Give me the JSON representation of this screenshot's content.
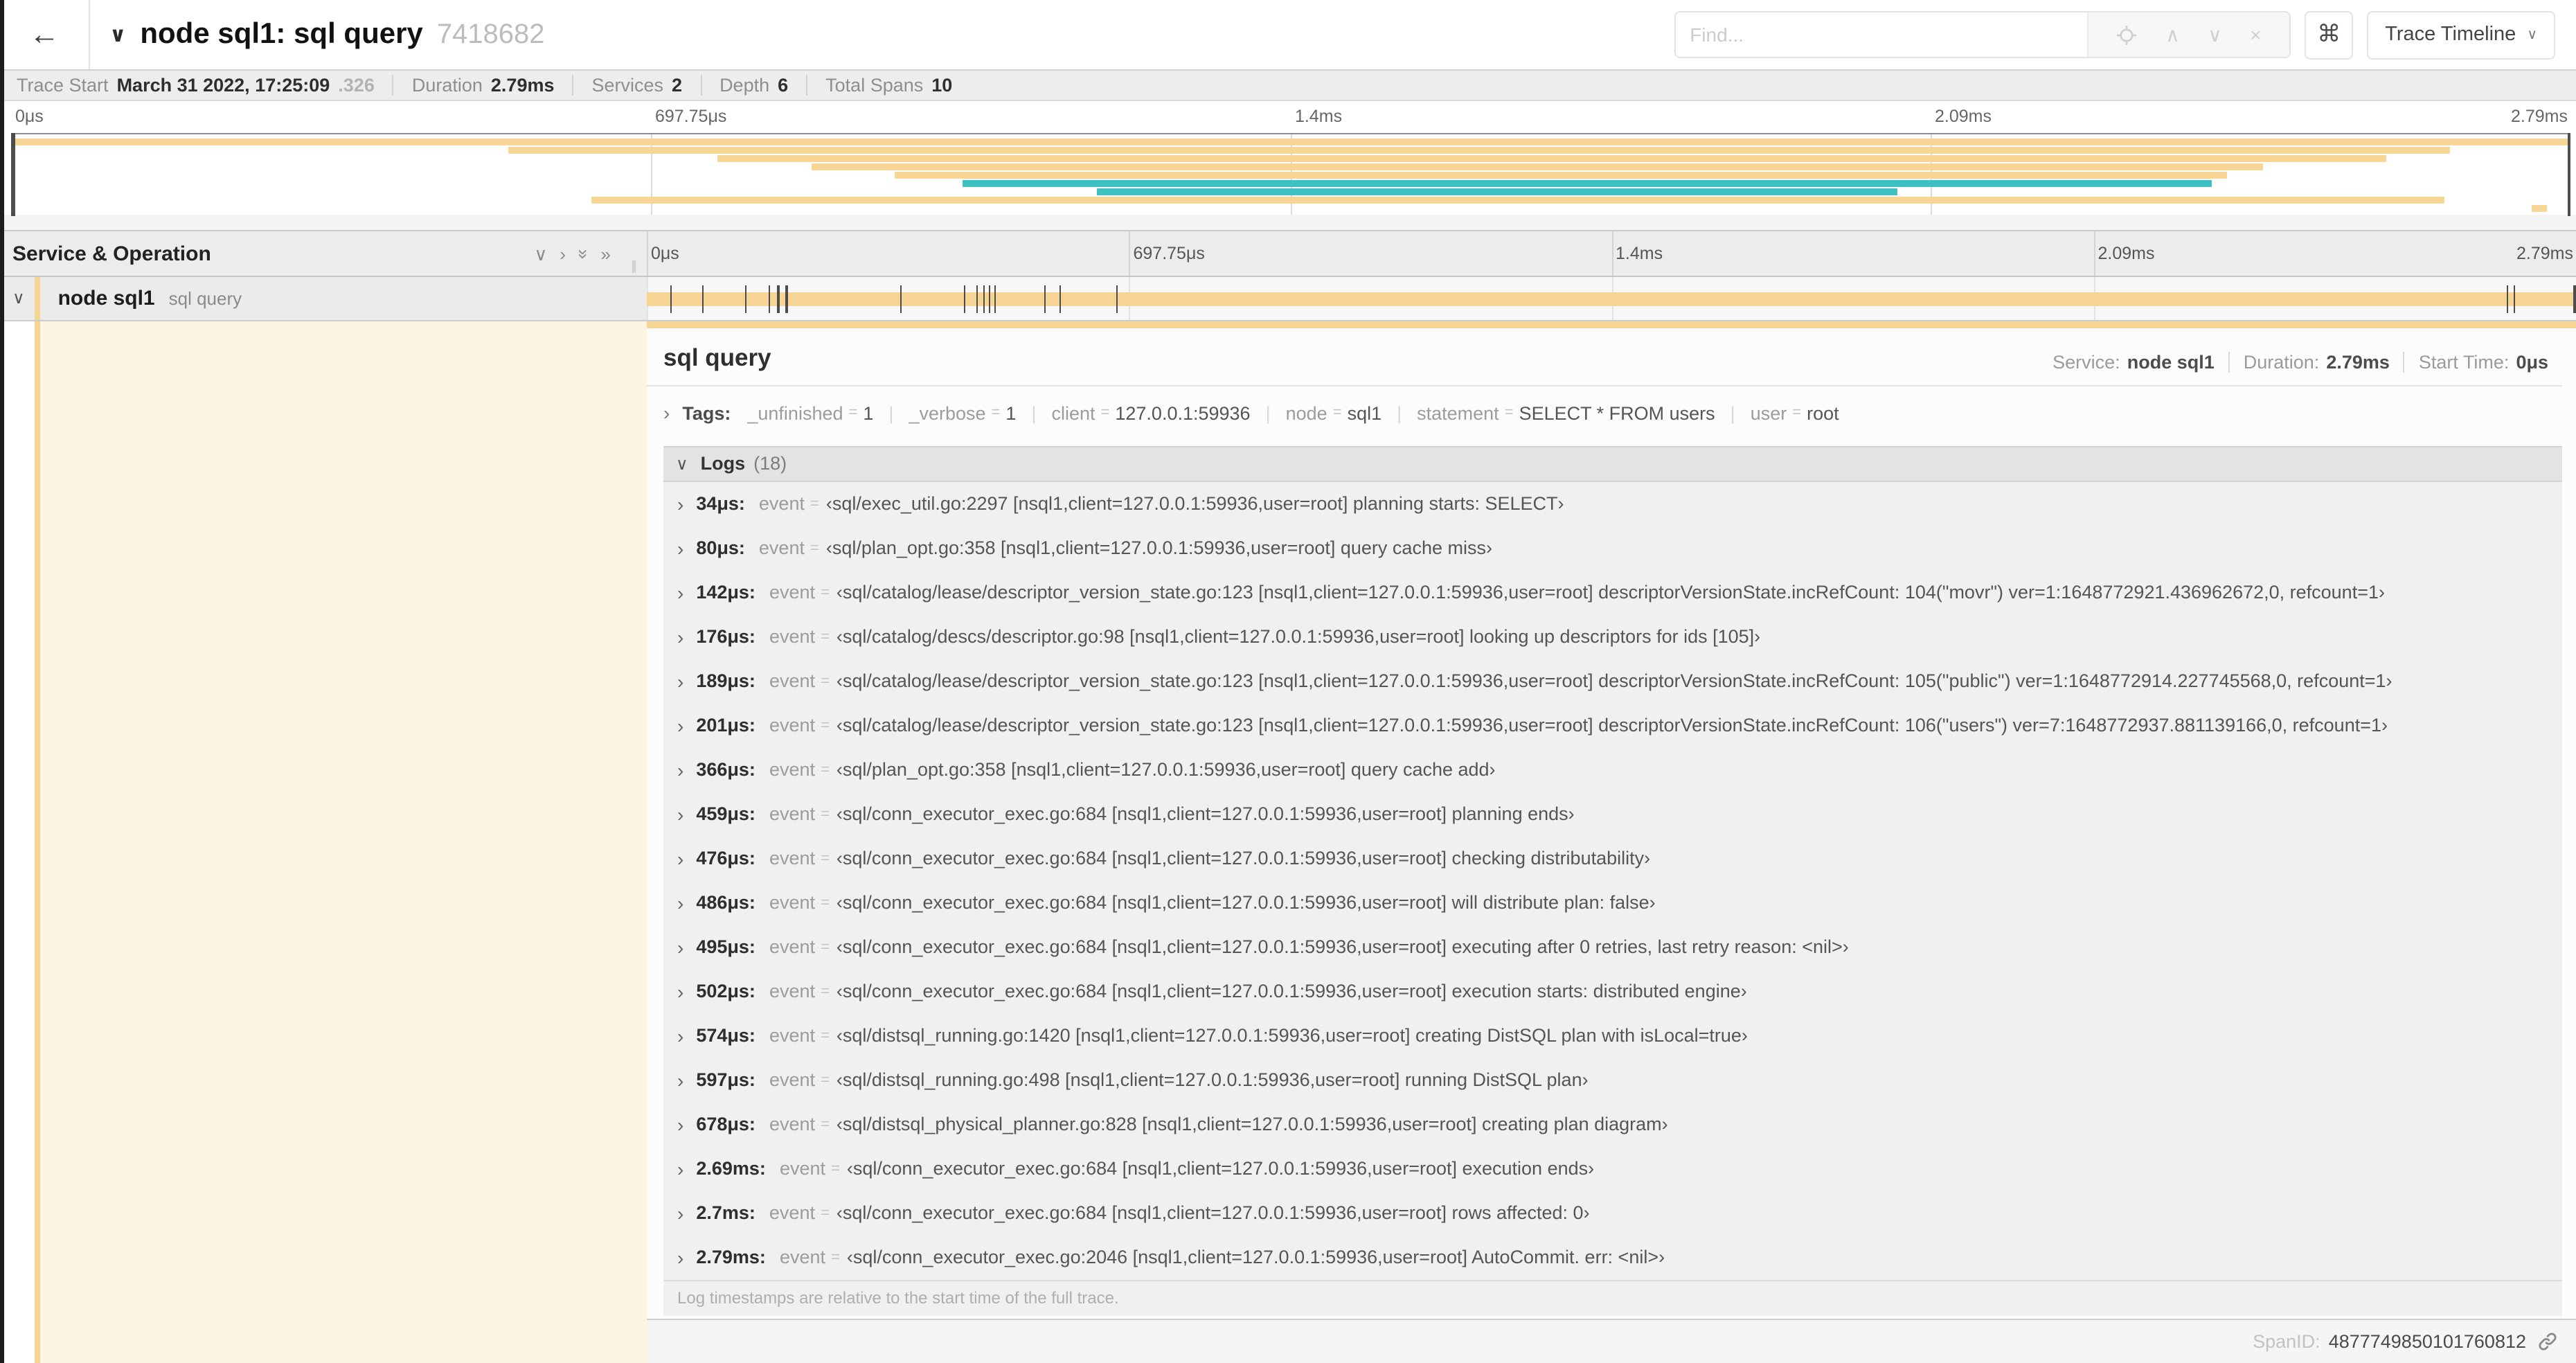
{
  "colors": {
    "tan": "#f6d595",
    "teal": "#3fc0c0",
    "cream": "#fdf5e2"
  },
  "duration_us": 2790,
  "header": {
    "back": "←",
    "title_chevron": "∨",
    "title": "node sql1: sql query",
    "trace_id": "7418682",
    "find_placeholder": "Find...",
    "shortcut": "⌘",
    "view_selector": "Trace Timeline",
    "view_chevron": "∨"
  },
  "summary": {
    "trace_start_label": "Trace Start",
    "trace_start": "March 31 2022, 17:25:09",
    "trace_start_frac": ".326",
    "duration_label": "Duration",
    "duration": "2.79ms",
    "services_label": "Services",
    "services": "2",
    "depth_label": "Depth",
    "depth": "6",
    "total_spans_label": "Total Spans",
    "total_spans": "10"
  },
  "ticks": [
    {
      "label": "0μs",
      "pos": 0
    },
    {
      "label": "697.75μs",
      "pos": 0.25
    },
    {
      "label": "1.4ms",
      "pos": 0.5
    },
    {
      "label": "2.09ms",
      "pos": 0.75
    },
    {
      "label": "2.79ms",
      "pos": 1
    }
  ],
  "minimap": {
    "spans": [
      {
        "s": 0.0,
        "e": 1.0,
        "c": "tan"
      },
      {
        "s": 0.194,
        "e": 0.953,
        "c": "tan"
      },
      {
        "s": 0.276,
        "e": 0.928,
        "c": "tan"
      },
      {
        "s": 0.313,
        "e": 0.88,
        "c": "tan"
      },
      {
        "s": 0.345,
        "e": 0.866,
        "c": "tan"
      },
      {
        "s": 0.372,
        "e": 0.86,
        "c": "teal"
      },
      {
        "s": 0.424,
        "e": 0.737,
        "c": "teal"
      },
      {
        "s": 0.227,
        "e": 0.951,
        "c": "tan"
      },
      {
        "s": 0.985,
        "e": 0.991,
        "c": "tan"
      }
    ]
  },
  "timeline": {
    "left_header": "Service & Operation"
  },
  "span_row": {
    "chevron": "∨",
    "service": "node sql1",
    "operation": "sql query"
  },
  "detail": {
    "title": "sql query",
    "service_label": "Service:",
    "service": "node sql1",
    "duration_label": "Duration:",
    "duration": "2.79ms",
    "start_label": "Start Time:",
    "start": "0μs",
    "tags_chevron": "›",
    "tags_label": "Tags:",
    "tags": [
      {
        "key": "_unfinished",
        "value": "1"
      },
      {
        "key": "_verbose",
        "value": "1"
      },
      {
        "key": "client",
        "value": "127.0.0.1:59936"
      },
      {
        "key": "node",
        "value": "sql1"
      },
      {
        "key": "statement",
        "value": "SELECT * FROM users"
      },
      {
        "key": "user",
        "value": "root"
      }
    ],
    "logs_chevron": "∨",
    "logs_label": "Logs",
    "logs_count": "(18)",
    "logs": [
      {
        "t": "34μs",
        "us": 34,
        "msg": "‹sql/exec_util.go:2297 [nsql1,client=127.0.0.1:59936,user=root] planning starts: SELECT›"
      },
      {
        "t": "80μs",
        "us": 80,
        "msg": "‹sql/plan_opt.go:358 [nsql1,client=127.0.0.1:59936,user=root] query cache miss›"
      },
      {
        "t": "142μs",
        "us": 142,
        "msg": "‹sql/catalog/lease/descriptor_version_state.go:123 [nsql1,client=127.0.0.1:59936,user=root] descriptorVersionState.incRefCount: 104(\"movr\") ver=1:1648772921.436962672,0, refcount=1›"
      },
      {
        "t": "176μs",
        "us": 176,
        "msg": "‹sql/catalog/descs/descriptor.go:98 [nsql1,client=127.0.0.1:59936,user=root] looking up descriptors for ids [105]›"
      },
      {
        "t": "189μs",
        "us": 189,
        "msg": "‹sql/catalog/lease/descriptor_version_state.go:123 [nsql1,client=127.0.0.1:59936,user=root] descriptorVersionState.incRefCount: 105(\"public\") ver=1:1648772914.227745568,0, refcount=1›"
      },
      {
        "t": "201μs",
        "us": 201,
        "msg": "‹sql/catalog/lease/descriptor_version_state.go:123 [nsql1,client=127.0.0.1:59936,user=root] descriptorVersionState.incRefCount: 106(\"users\") ver=7:1648772937.881139166,0, refcount=1›"
      },
      {
        "t": "366μs",
        "us": 366,
        "msg": "‹sql/plan_opt.go:358 [nsql1,client=127.0.0.1:59936,user=root] query cache add›"
      },
      {
        "t": "459μs",
        "us": 459,
        "msg": "‹sql/conn_executor_exec.go:684 [nsql1,client=127.0.0.1:59936,user=root] planning ends›"
      },
      {
        "t": "476μs",
        "us": 476,
        "msg": "‹sql/conn_executor_exec.go:684 [nsql1,client=127.0.0.1:59936,user=root] checking distributability›"
      },
      {
        "t": "486μs",
        "us": 486,
        "msg": "‹sql/conn_executor_exec.go:684 [nsql1,client=127.0.0.1:59936,user=root] will distribute plan: false›"
      },
      {
        "t": "495μs",
        "us": 495,
        "msg": "‹sql/conn_executor_exec.go:684 [nsql1,client=127.0.0.1:59936,user=root] executing after 0 retries, last retry reason: <nil>›"
      },
      {
        "t": "502μs",
        "us": 502,
        "msg": "‹sql/conn_executor_exec.go:684 [nsql1,client=127.0.0.1:59936,user=root] execution starts: distributed engine›"
      },
      {
        "t": "574μs",
        "us": 574,
        "msg": "‹sql/distsql_running.go:1420 [nsql1,client=127.0.0.1:59936,user=root] creating DistSQL plan with isLocal=true›"
      },
      {
        "t": "597μs",
        "us": 597,
        "msg": "‹sql/distsql_running.go:498 [nsql1,client=127.0.0.1:59936,user=root] running DistSQL plan›"
      },
      {
        "t": "678μs",
        "us": 678,
        "msg": "‹sql/distsql_physical_planner.go:828 [nsql1,client=127.0.0.1:59936,user=root] creating plan diagram›"
      },
      {
        "t": "2.69ms",
        "us": 2690,
        "msg": "‹sql/conn_executor_exec.go:684 [nsql1,client=127.0.0.1:59936,user=root] execution ends›"
      },
      {
        "t": "2.7ms",
        "us": 2700,
        "msg": "‹sql/conn_executor_exec.go:684 [nsql1,client=127.0.0.1:59936,user=root] rows affected: 0›"
      },
      {
        "t": "2.79ms",
        "us": 2790,
        "msg": "‹sql/conn_executor_exec.go:2046 [nsql1,client=127.0.0.1:59936,user=root] AutoCommit. err: <nil>›"
      }
    ],
    "logs_note": "Log timestamps are relative to the start time of the full trace.",
    "span_id_label": "SpanID:",
    "span_id": "4877749850101760812"
  }
}
